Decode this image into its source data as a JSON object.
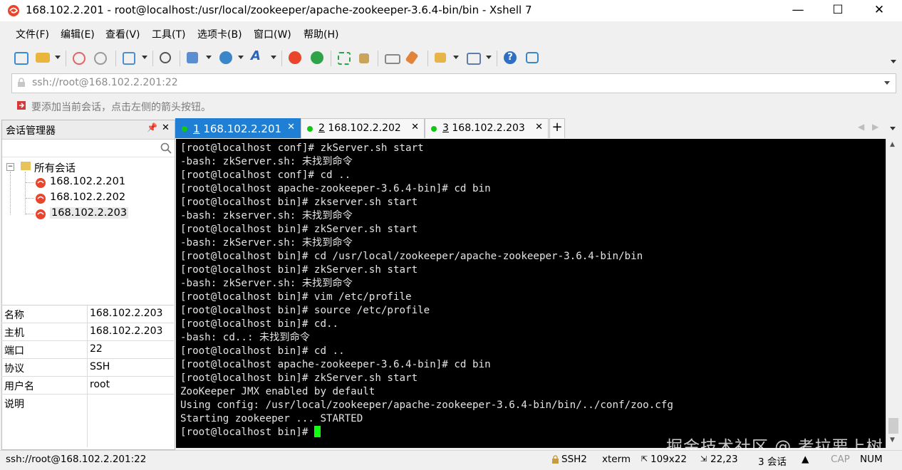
{
  "window": {
    "title": "168.102.2.201 - root@localhost:/usr/local/zookeeper/apache-zookeeper-3.6.4-bin/bin - Xshell 7",
    "minimize": "—",
    "maximize": "☐",
    "close": "✕"
  },
  "menu": [
    "文件(F)",
    "编辑(E)",
    "查看(V)",
    "工具(T)",
    "选项卡(B)",
    "窗口(W)",
    "帮助(H)"
  ],
  "address": {
    "value": "ssh://root@168.102.2.201:22"
  },
  "hint": "要添加当前会话，点击左侧的箭头按钮。",
  "sidebar": {
    "title": "会话管理器",
    "pin": "📌",
    "close": "✕",
    "tree_root": "所有会话",
    "sessions": [
      "168.102.2.201",
      "168.102.2.202",
      "168.102.2.203"
    ]
  },
  "properties": [
    {
      "key": "名称",
      "value": "168.102.2.203"
    },
    {
      "key": "主机",
      "value": "168.102.2.203"
    },
    {
      "key": "端口",
      "value": "22"
    },
    {
      "key": "协议",
      "value": "SSH"
    },
    {
      "key": "用户名",
      "value": "root"
    },
    {
      "key": "说明",
      "value": ""
    }
  ],
  "tabs": [
    {
      "num": "1",
      "label": "168.102.2.201",
      "active": true
    },
    {
      "num": "2",
      "label": "168.102.2.202",
      "active": false
    },
    {
      "num": "3",
      "label": "168.102.2.203",
      "active": false
    }
  ],
  "tab_add": "+",
  "terminal_lines": [
    "[root@localhost conf]# zkServer.sh start",
    "-bash: zkServer.sh: 未找到命令",
    "[root@localhost conf]# cd ..",
    "[root@localhost apache-zookeeper-3.6.4-bin]# cd bin",
    "[root@localhost bin]# zkserver.sh start",
    "-bash: zkserver.sh: 未找到命令",
    "[root@localhost bin]# zkServer.sh start",
    "-bash: zkServer.sh: 未找到命令",
    "[root@localhost bin]# cd /usr/local/zookeeper/apache-zookeeper-3.6.4-bin/bin",
    "[root@localhost bin]# zkServer.sh start",
    "-bash: zkServer.sh: 未找到命令",
    "[root@localhost bin]# vim /etc/profile",
    "[root@localhost bin]# source /etc/profile",
    "[root@localhost bin]# cd..",
    "-bash: cd..: 未找到命令",
    "[root@localhost bin]# cd ..",
    "[root@localhost apache-zookeeper-3.6.4-bin]# cd bin",
    "[root@localhost bin]# zkServer.sh start",
    "ZooKeeper JMX enabled by default",
    "Using config: /usr/local/zookeeper/apache-zookeeper-3.6.4-bin/bin/../conf/zoo.cfg",
    "Starting zookeeper ... STARTED",
    "[root@localhost bin]# "
  ],
  "status": {
    "connection": "ssh://root@168.102.2.201:22",
    "protocol": "SSH2",
    "terminal": "xterm",
    "size": "109x22",
    "position": "22,23",
    "sessions": "3 会话",
    "cap": "CAP",
    "num": "NUM"
  },
  "watermark": "掘金技术社区 @ 考拉要上树",
  "colors": {
    "active_tab": "#1f7fd4",
    "connected_dot": "#14c614",
    "cursor": "#10ff10",
    "terminal_bg": "#000000"
  }
}
